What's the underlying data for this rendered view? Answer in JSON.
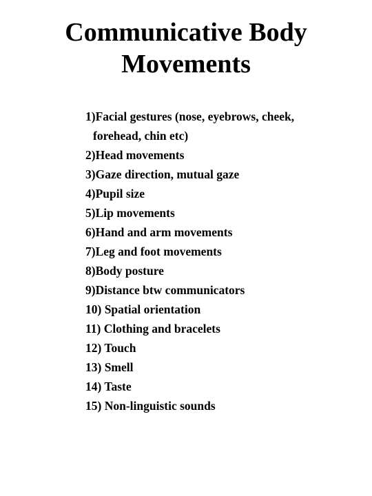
{
  "document": {
    "title_line_1": "Communicative Body",
    "title_line_2": "Movements",
    "title_full": "Communicative Body\nMovements",
    "background_color": "#ffffff",
    "text_color": "#000000"
  },
  "body": {
    "list_items": [
      {
        "marker": "1)",
        "text": "Facial gestures (nose, eyebrows, cheek, forehead, chin etc)",
        "full": "1)Facial gestures (nose, eyebrows, cheek, forehead, chin etc)"
      },
      {
        "marker": "2)",
        "text": "Head movements",
        "full": "2)Head movements"
      },
      {
        "marker": "3)",
        "text": "Gaze direction, mutual gaze",
        "full": "3)Gaze direction, mutual gaze"
      },
      {
        "marker": "4)",
        "text": "Pupil size",
        "full": "4)Pupil size"
      },
      {
        "marker": "5)",
        "text": "Lip movements",
        "full": "5)Lip movements"
      },
      {
        "marker": "6)",
        "text": "Hand and arm movements",
        "full": "6)Hand and arm movements"
      },
      {
        "marker": "7)",
        "text": "Leg and foot movements",
        "full": "7)Leg and foot movements"
      },
      {
        "marker": "8)",
        "text": "Body posture",
        "full": "8)Body posture"
      },
      {
        "marker": "9)",
        "text": "Distance btw communicators",
        "full": "9)Distance btw communicators"
      },
      {
        "marker": "10)",
        "text": "Spatial orientation",
        "full": "10) Spatial orientation"
      },
      {
        "marker": "11)",
        "text": "Clothing and bracelets",
        "full": "11) Clothing and bracelets"
      },
      {
        "marker": "12)",
        "text": "Touch",
        "full": "12) Touch"
      },
      {
        "marker": "13)",
        "text": "Smell",
        "full": "13) Smell"
      },
      {
        "marker": "14)",
        "text": "Taste",
        "full": "14) Taste"
      },
      {
        "marker": "15)",
        "text": "Non-linguistic sounds",
        "full": "15) Non-linguistic sounds"
      }
    ]
  }
}
